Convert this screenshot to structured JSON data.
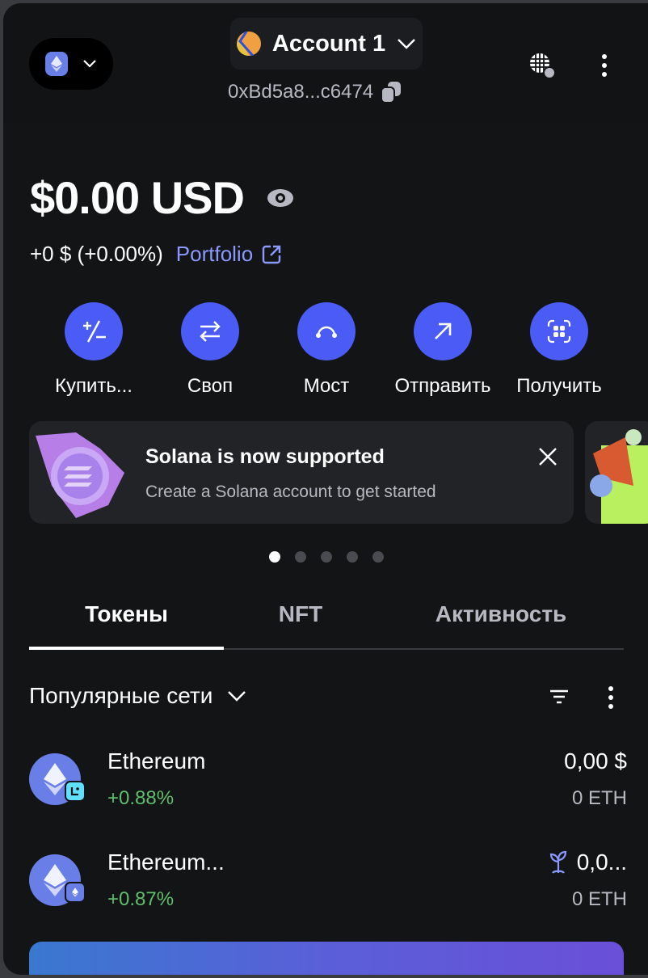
{
  "header": {
    "account_name": "Account 1",
    "address": "0xBd5a8...c6474"
  },
  "balance": {
    "amount": "$0.00",
    "currency": "USD",
    "change": "+0 $ (+0.00%)",
    "portfolio_label": "Portfolio"
  },
  "actions": [
    {
      "label": "Купить...",
      "icon": "buy-sell-icon"
    },
    {
      "label": "Своп",
      "icon": "swap-icon"
    },
    {
      "label": "Мост",
      "icon": "bridge-icon"
    },
    {
      "label": "Отправить",
      "icon": "send-icon"
    },
    {
      "label": "Получить",
      "icon": "receive-icon"
    }
  ],
  "banner": {
    "title": "Solana is now supported",
    "subtitle": "Create a Solana account to get started"
  },
  "carousel": {
    "count": 5,
    "active": 0
  },
  "tabs": [
    {
      "label": "Токены",
      "active": true
    },
    {
      "label": "NFT"
    },
    {
      "label": "Активность"
    }
  ],
  "network_filter": {
    "label": "Популярные сети"
  },
  "tokens": [
    {
      "name": "Ethereum",
      "change": "+0.88%",
      "fiat": "0,00 $",
      "amount": "0 ETH",
      "badge": "linea"
    },
    {
      "name": "Ethereum...",
      "change": "+0.87%",
      "fiat": "0,0...",
      "amount": "0 ETH",
      "badge": "ethereum",
      "staking_icon": "sprout-icon"
    }
  ],
  "colors": {
    "accent": "#4a5cf5",
    "link": "#8b99ff",
    "positive": "#5fbf6c",
    "background": "#131416"
  }
}
